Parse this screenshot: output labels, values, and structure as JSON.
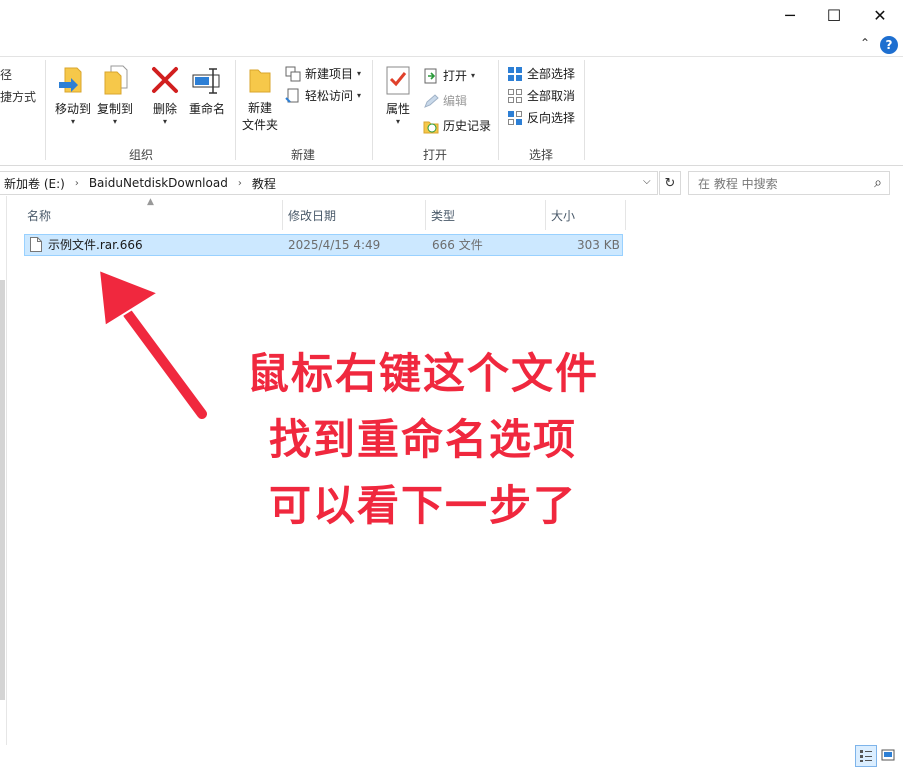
{
  "window": {
    "minimize_glyph": "─",
    "maximize_glyph": "☐",
    "close_glyph": "✕",
    "help_glyph": "?",
    "collapse_glyph": "⌃"
  },
  "ribbon": {
    "partial_left": [
      "径",
      "捷方式"
    ],
    "organize": {
      "label": "组织",
      "move_to": "移动到",
      "copy_to": "复制到",
      "delete": "删除",
      "rename": "重命名"
    },
    "new": {
      "label": "新建",
      "new_folder": "新建\n文件夹",
      "new_item": "新建项目",
      "easy_access": "轻松访问"
    },
    "open": {
      "label": "打开",
      "properties": "属性",
      "open": "打开",
      "edit": "编辑",
      "history": "历史记录"
    },
    "select": {
      "label": "选择",
      "select_all": "全部选择",
      "select_none": "全部取消",
      "invert": "反向选择"
    }
  },
  "address": {
    "crumbs": [
      "新加卷 (E:)",
      "BaiduNetdiskDownload",
      "教程"
    ],
    "search_placeholder": "在 教程 中搜索"
  },
  "columns": {
    "name": "名称",
    "modified": "修改日期",
    "type": "类型",
    "size": "大小"
  },
  "files": [
    {
      "name": "示例文件.rar.666",
      "modified": "2025/4/15 4:49",
      "type": "666 文件",
      "size": "303 KB"
    }
  ],
  "annotation": {
    "line1": "鼠标右键这个文件",
    "line2": "找到重命名选项",
    "line3": "可以看下一步了",
    "color": "#f0283e"
  },
  "colors": {
    "selection_bg": "#cce8ff",
    "selection_border": "#99d1ff",
    "accent": "#0078d7"
  },
  "icons": {
    "sort": "▲",
    "refresh": "↻",
    "search": "⌕",
    "dropdown": "⌵"
  }
}
